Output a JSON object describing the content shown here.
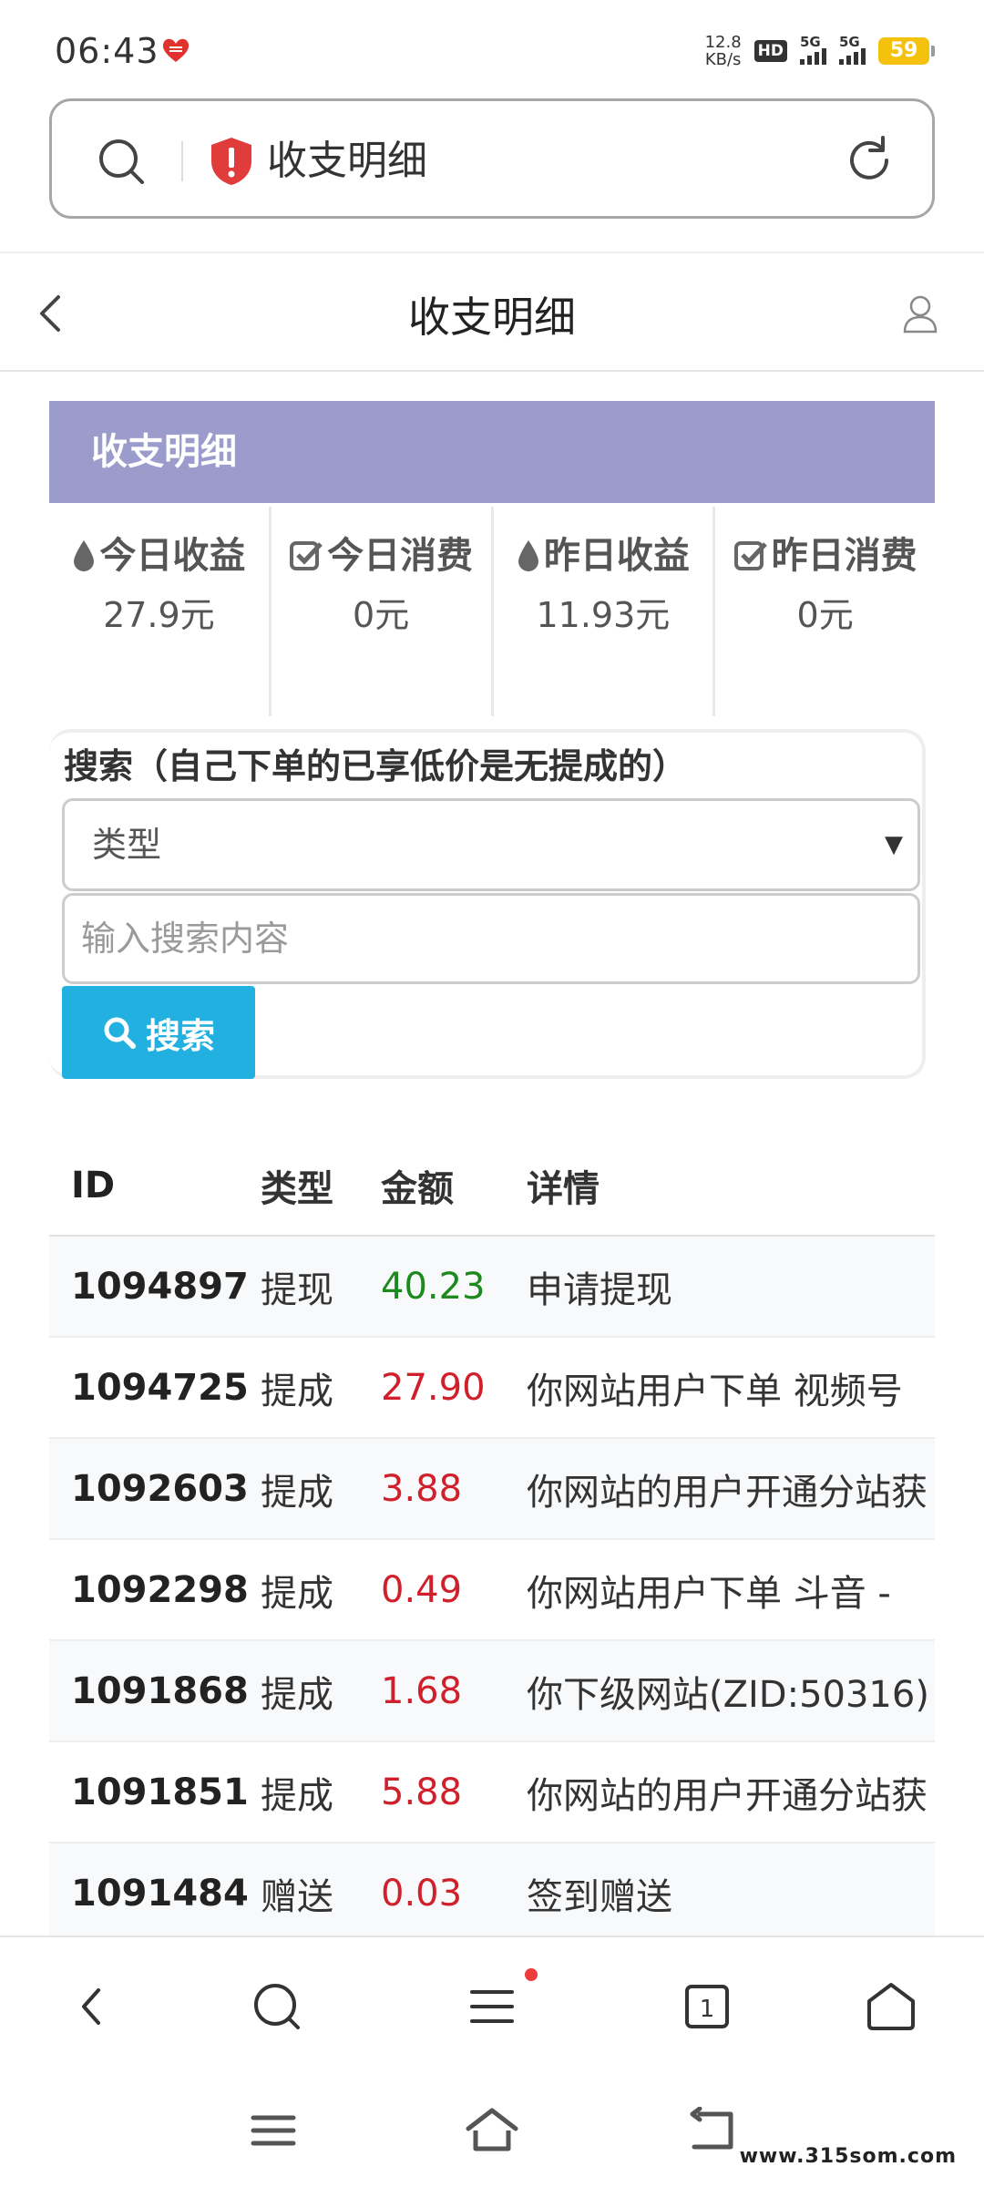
{
  "status_bar": {
    "time": "06:43",
    "net_speed_value": "12.8",
    "net_speed_unit": "KB/s",
    "hd_label": "HD",
    "signal_label": "5G",
    "battery": "59"
  },
  "address_bar": {
    "page_title": "收支明细"
  },
  "page_header": {
    "title": "收支明细"
  },
  "panel": {
    "title": "收支明细",
    "stats": [
      {
        "label": "今日收益",
        "value": "27.9元",
        "icon": "drop-icon"
      },
      {
        "label": "今日消费",
        "value": "0元",
        "icon": "check-square-icon"
      },
      {
        "label": "昨日收益",
        "value": "11.93元",
        "icon": "drop-icon"
      },
      {
        "label": "昨日消费",
        "value": "0元",
        "icon": "check-square-icon"
      }
    ]
  },
  "search": {
    "title": "搜索（自己下单的已享低价是无提成的）",
    "type_select_value": "类型",
    "input_placeholder": "输入搜索内容",
    "button_label": "搜索"
  },
  "table": {
    "headers": {
      "id": "ID",
      "type": "类型",
      "amount": "金额",
      "detail": "详情"
    },
    "rows": [
      {
        "id": "1094897",
        "type": "提现",
        "amount": "40.23",
        "detail": "申请提现"
      },
      {
        "id": "1094725",
        "type": "提成",
        "amount": "27.90",
        "detail": "你网站用户下单 视频号"
      },
      {
        "id": "1092603",
        "type": "提成",
        "amount": "3.88",
        "detail": "你网站的用户开通分站获"
      },
      {
        "id": "1092298",
        "type": "提成",
        "amount": "0.49",
        "detail": "你网站用户下单 斗音 -"
      },
      {
        "id": "1091868",
        "type": "提成",
        "amount": "1.68",
        "detail": "你下级网站(ZID:50316)"
      },
      {
        "id": "1091851",
        "type": "提成",
        "amount": "5.88",
        "detail": "你网站的用户开通分站获"
      },
      {
        "id": "1091484",
        "type": "赠送",
        "amount": "0.03",
        "detail": "签到赠送"
      }
    ]
  },
  "colors": {
    "panel_header": "#9b9ccc",
    "search_button": "#21b0e0",
    "amount_withdraw": "#1d8a1d",
    "amount_income": "#d0202c"
  },
  "browser_nav": {
    "tab_count": "1"
  },
  "watermark": "www.315som.com"
}
